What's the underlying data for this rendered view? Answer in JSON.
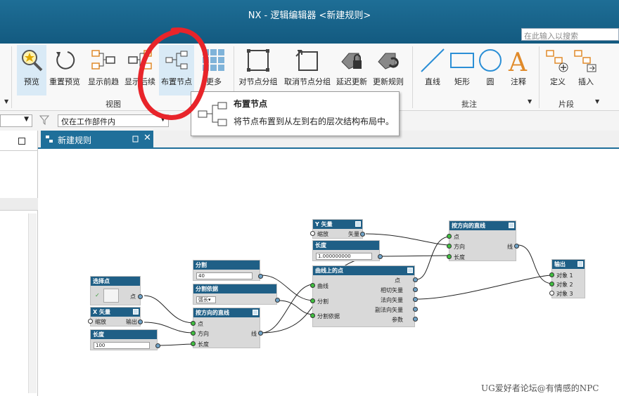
{
  "window": {
    "title": "NX - 逻辑编辑器 <新建规则>",
    "search_placeholder": "在此输入以搜索"
  },
  "ribbon": {
    "buttons": [
      {
        "label": "预览",
        "icon": "preview-icon"
      },
      {
        "label": "重置预览",
        "icon": "reset-preview-icon"
      },
      {
        "label": "显示前趋",
        "icon": "show-predecessors-icon"
      },
      {
        "label": "显示后续",
        "icon": "show-successors-icon"
      },
      {
        "label": "布置节点",
        "icon": "arrange-nodes-icon"
      },
      {
        "label": "更多",
        "icon": "more-grid-icon"
      },
      {
        "label": "对节点分组",
        "icon": "group-nodes-icon"
      },
      {
        "label": "取消节点分组",
        "icon": "ungroup-nodes-icon"
      },
      {
        "label": "延迟更新",
        "icon": "delay-update-icon"
      },
      {
        "label": "更新规则",
        "icon": "update-rule-icon"
      },
      {
        "label": "直线",
        "icon": "line-icon"
      },
      {
        "label": "矩形",
        "icon": "rectangle-icon"
      },
      {
        "label": "圆",
        "icon": "circle-icon"
      },
      {
        "label": "注释",
        "icon": "annotation-icon"
      },
      {
        "label": "定义",
        "icon": "define-icon"
      },
      {
        "label": "插入",
        "icon": "insert-icon"
      }
    ],
    "groups": {
      "view": "视图",
      "annotation": "批注",
      "fragment": "片段"
    }
  },
  "tooltip": {
    "title": "布置节点",
    "description": "将节点布置到从左到右的层次结构布局中。"
  },
  "filter": {
    "scope": "仅在工作部件内"
  },
  "tab": {
    "label": "新建规则"
  },
  "nodes": {
    "select_point": {
      "title": "选择点",
      "out": "点"
    },
    "x_vector": {
      "title": "X 矢量",
      "in": "缩放",
      "out": "输出"
    },
    "length1": {
      "title": "长度",
      "value": "100"
    },
    "divide": {
      "title": "分割",
      "value": "40"
    },
    "divide_basis": {
      "title": "分割依据",
      "value": "弧长"
    },
    "dir_line1": {
      "title": "按方向的直线",
      "in1": "点",
      "in2": "方向",
      "in3": "长度",
      "out": "线"
    },
    "y_vector": {
      "title": "Y 矢量",
      "in": "缩放",
      "out": "矢量"
    },
    "length2": {
      "title": "长度",
      "value": "1.000000000"
    },
    "point_on_curve": {
      "title": "曲线上的点",
      "in1": "曲线",
      "in2": "分割",
      "in3": "分割依据",
      "out1": "点",
      "out2": "相切矢量",
      "out3": "法向矢量",
      "out4": "副法向矢量",
      "out5": "参数"
    },
    "dir_line2": {
      "title": "按方向的直线",
      "in1": "点",
      "in2": "方向",
      "in3": "长度",
      "out": "线"
    },
    "output": {
      "title": "输出",
      "in1": "对象 1",
      "in2": "对象 2",
      "in3": "对象 3"
    }
  },
  "watermark": "UG爱好者论坛@有情感的NPC"
}
